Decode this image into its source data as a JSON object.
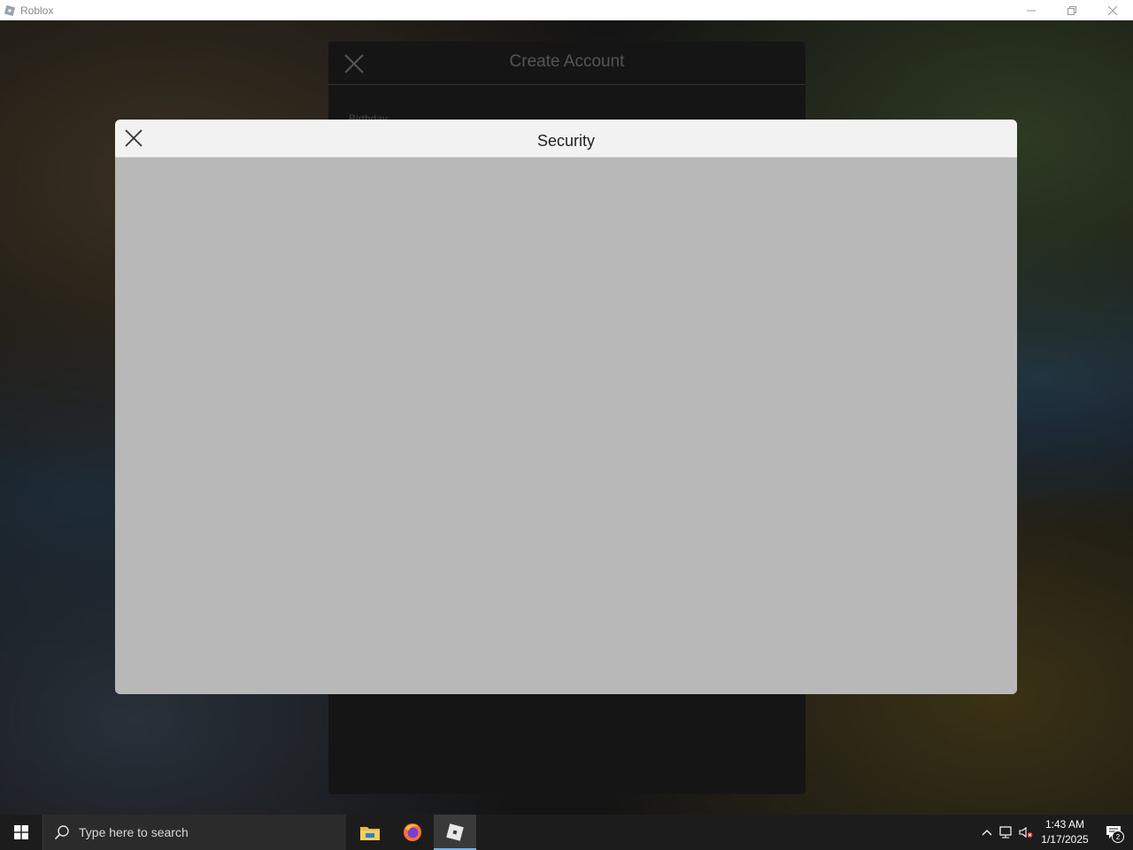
{
  "window": {
    "title": "Roblox"
  },
  "create_account": {
    "title": "Create Account",
    "field_label": "Birthday"
  },
  "security_modal": {
    "title": "Security"
  },
  "taskbar": {
    "search_placeholder": "Type here to search",
    "apps": [
      "file-explorer-icon",
      "firefox-icon",
      "roblox-icon"
    ],
    "active_app": "roblox-icon",
    "clock_time": "1:43 AM",
    "clock_date": "1/17/2025",
    "notification_count": "2"
  },
  "colors": {
    "modal_body": "#b8b8b8",
    "modal_header": "#f2f2f2",
    "taskbar": "#1c1c1c",
    "active_indicator": "#7ab4e6"
  }
}
